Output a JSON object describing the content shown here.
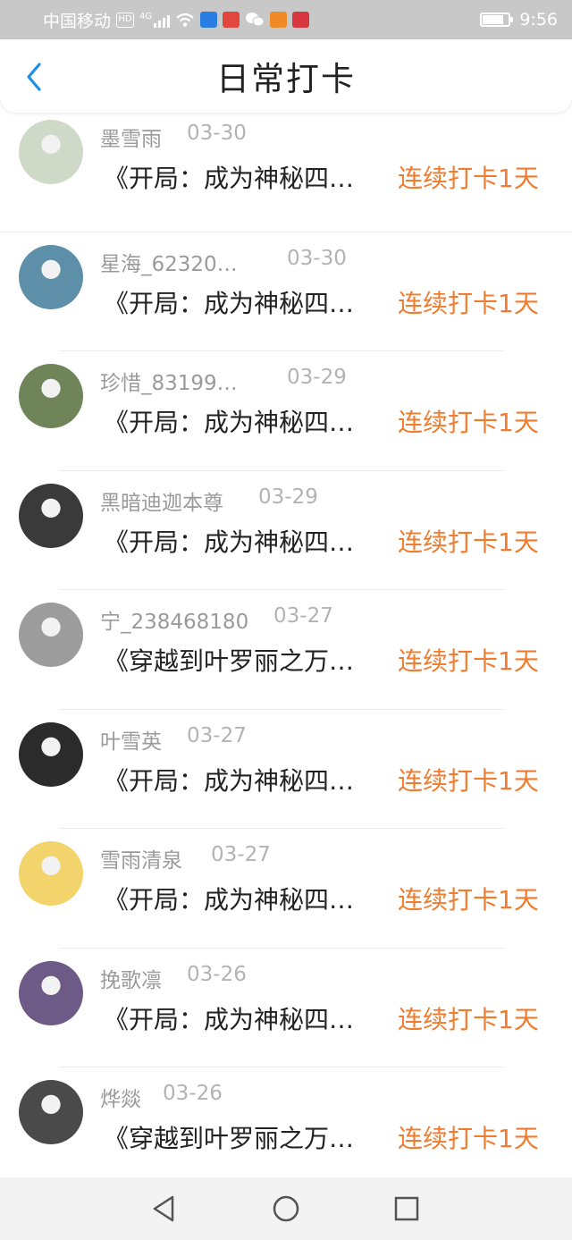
{
  "status_bar": {
    "carrier": "中国移动",
    "hd_badge": "HD",
    "network": "4G",
    "time": "9:56",
    "battery_level": 0.75,
    "icons": [
      "hd-icon",
      "signal-icon",
      "wifi-icon",
      "app-icon-blue",
      "app-icon-red-book",
      "wechat-icon",
      "video-app-icon",
      "app-icon-red-heart"
    ]
  },
  "header": {
    "title": "日常打卡",
    "back_icon": "chevron-left-icon"
  },
  "checkins": [
    {
      "user": "墨雪雨",
      "date": "03-30",
      "book": "《开局：成为神秘四…",
      "streak": "连续打卡1天",
      "avatar_color": "#cfd9c8"
    },
    {
      "user": "星海_62320…",
      "date": "03-30",
      "book": "《开局：成为神秘四…",
      "streak": "连续打卡1天",
      "avatar_color": "#5d8fa8"
    },
    {
      "user": "珍惜_83199…",
      "date": "03-29",
      "book": "《开局：成为神秘四…",
      "streak": "连续打卡1天",
      "avatar_color": "#6f8458"
    },
    {
      "user": "黑暗迪迦本尊",
      "date": "03-29",
      "book": "《开局：成为神秘四…",
      "streak": "连续打卡1天",
      "avatar_color": "#3a3a3a"
    },
    {
      "user": "宁_238468180",
      "date": "03-27",
      "book": "《穿越到叶罗丽之万…",
      "streak": "连续打卡1天",
      "avatar_color": "#9c9c9c"
    },
    {
      "user": "叶雪英",
      "date": "03-27",
      "book": "《开局：成为神秘四…",
      "streak": "连续打卡1天",
      "avatar_color": "#2b2b2b"
    },
    {
      "user": "雪雨清泉",
      "date": "03-27",
      "book": "《开局：成为神秘四…",
      "streak": "连续打卡1天",
      "avatar_color": "#f3d36b"
    },
    {
      "user": "挽歌凛",
      "date": "03-26",
      "book": "《开局：成为神秘四…",
      "streak": "连续打卡1天",
      "avatar_color": "#6e5a86"
    },
    {
      "user": "烨燚",
      "date": "03-26",
      "book": "《穿越到叶罗丽之万…",
      "streak": "连续打卡1天",
      "avatar_color": "#4a4a4a"
    }
  ],
  "nav": {
    "back": "triangle-back-icon",
    "home": "circle-home-icon",
    "recents": "square-recents-icon"
  },
  "colors": {
    "accent_orange": "#f07c2f",
    "back_blue": "#1e8fe6"
  }
}
